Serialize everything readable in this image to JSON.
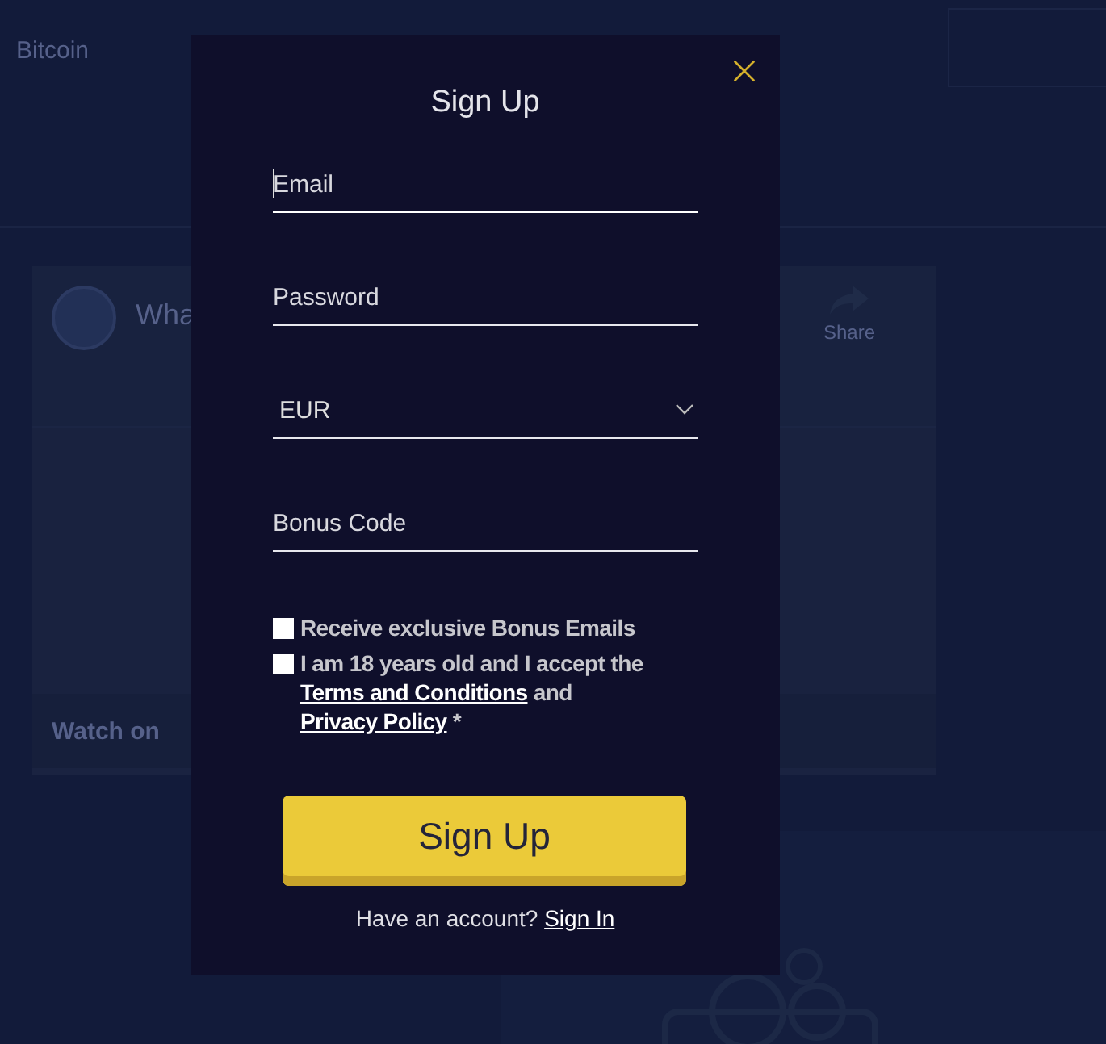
{
  "background": {
    "brand": "Bitcoin",
    "video": {
      "title": "Wha",
      "share": "Share",
      "watch": "Watch on"
    }
  },
  "modal": {
    "title": "Sign Up",
    "fields": [
      {
        "kind": "text",
        "placeholder": "Email",
        "focused": true
      },
      {
        "kind": "password",
        "placeholder": "Password",
        "focused": false
      },
      {
        "kind": "select",
        "value": "EUR",
        "focused": false
      },
      {
        "kind": "text",
        "placeholder": "Bonus Code",
        "focused": false
      }
    ],
    "checkboxes": [
      {
        "checked": false,
        "parts": [
          {
            "text": "Receive exclusive Bonus Emails",
            "kind": "text"
          }
        ]
      },
      {
        "checked": false,
        "parts": [
          {
            "text": "I am 18 years old and I accept the ",
            "kind": "text"
          },
          {
            "text": "Terms and Conditions",
            "kind": "link"
          },
          {
            "text": " and ",
            "kind": "text"
          },
          {
            "text": "Privacy Policy",
            "kind": "link"
          },
          {
            "text": " *",
            "kind": "text"
          }
        ]
      }
    ],
    "submit": "Sign Up",
    "footer": {
      "text": "Have an account? ",
      "link": "Sign In"
    }
  }
}
